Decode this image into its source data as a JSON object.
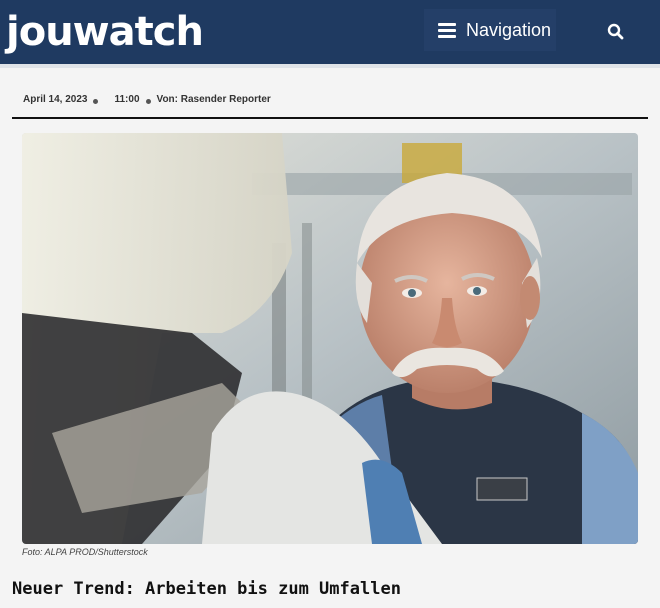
{
  "header": {
    "logo_text": "jouwatch",
    "nav_label": "Navigation",
    "brand_color": "#1f3a61"
  },
  "meta": {
    "date": "April 14, 2023",
    "time": "11:00",
    "author": "Von: Rasender Reporter"
  },
  "article": {
    "image_icon": "photo-older-mechanic",
    "caption": "Foto: ALPA PROD/Shutterstock",
    "title": "Neuer Trend: Arbeiten bis zum Umfallen"
  }
}
